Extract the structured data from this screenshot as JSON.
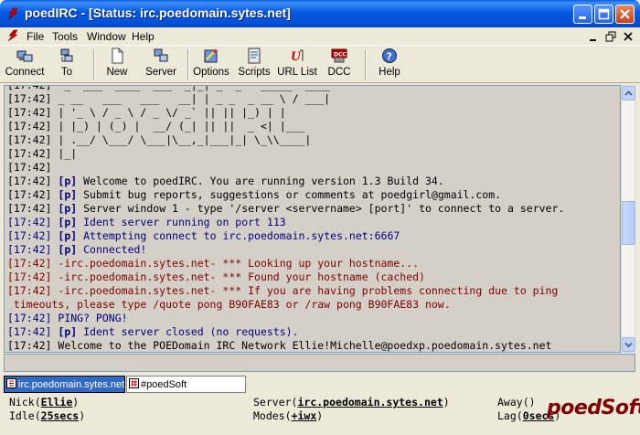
{
  "window": {
    "title": "poedIRC - [Status: irc.poedomain.sytes.net]"
  },
  "menu": {
    "items": [
      "File",
      "Tools",
      "Window",
      "Help"
    ]
  },
  "toolbar": {
    "buttons": [
      "Connect",
      "To",
      "New",
      "Server",
      "Options",
      "Scripts",
      "URL List",
      "DCC",
      "Help"
    ]
  },
  "log": {
    "lines": [
      {
        "ts": "[17:42]",
        "text": "  _  ___  ____  ___  _|_| _  _   _____  ____",
        "kind": "black"
      },
      {
        "ts": "[17:42]",
        "text": " _ __   ___   ___   __| | _ _  _ __ \\ / ___|",
        "kind": "black"
      },
      {
        "ts": "[17:42]",
        "text": " | '_ \\ / _ \\ / _ \\/ _` || || |_) | |",
        "kind": "black"
      },
      {
        "ts": "[17:42]",
        "text": " | |_) | (_) |  __/ (_| || ||  _ <| |___",
        "kind": "black"
      },
      {
        "ts": "[17:42]",
        "text": " | .__/ \\___/ \\___|\\__,_|___|_| \\_\\\\____|",
        "kind": "black"
      },
      {
        "ts": "[17:42]",
        "text": " |_|",
        "kind": "black"
      },
      {
        "ts": "[17:42]",
        "text": "",
        "kind": "black"
      },
      {
        "ts": "[17:42]",
        "tag": "[p]",
        "text": "Welcome to poedIRC. You are running version 1.3 Build 34.",
        "kind": "black"
      },
      {
        "ts": "[17:42]",
        "tag": "[p]",
        "text": "Submit bug reports, suggestions or comments at poedgirl@gmail.com.",
        "kind": "black"
      },
      {
        "ts": "[17:42]",
        "tag": "[p]",
        "text": "Server window 1 - type '/server <servername> [port]' to connect to a server.",
        "kind": "black"
      },
      {
        "ts": "[17:42]",
        "tag": "[p]",
        "text": "Ident server running on port 113",
        "kind": "blue"
      },
      {
        "ts": "[17:42]",
        "tag": "[p]",
        "text": "Attempting connect to irc.poedomain.sytes.net:6667",
        "kind": "blue"
      },
      {
        "ts": "[17:42]",
        "tag": "[p]",
        "text": "Connected!",
        "kind": "blue"
      },
      {
        "ts": "[17:42]",
        "text": " -irc.poedomain.sytes.net- *** Looking up your hostname...",
        "kind": "red"
      },
      {
        "ts": "[17:42]",
        "text": " -irc.poedomain.sytes.net- *** Found your hostname (cached)",
        "kind": "red"
      },
      {
        "ts": "[17:42]",
        "text": " -irc.poedomain.sytes.net- *** If you are having problems connecting due to ping",
        "kind": "red"
      },
      {
        "ts": "",
        "text": " timeouts, please type /quote pong B90FAE83 or /raw pong B90FAE83 now.",
        "kind": "red"
      },
      {
        "ts": "[17:42]",
        "text": " PING? PONG!",
        "kind": "blue"
      },
      {
        "ts": "[17:42]",
        "tag": "[p]",
        "text": "Ident server closed (no requests).",
        "kind": "blue"
      },
      {
        "ts": "[17:42]",
        "text": " Welcome to the POEDomain IRC Network Ellie!Michelle@poedxp.poedomain.sytes.net",
        "kind": "black"
      }
    ]
  },
  "input": {
    "value": ""
  },
  "tabs": [
    {
      "label": "irc.poedomain.sytes.net",
      "active": true
    },
    {
      "label": "#poedSoft",
      "active": false
    }
  ],
  "status": {
    "nick_label": "Nick",
    "nick_value": "Ellie",
    "idle_label": "Idle",
    "idle_value": "25secs",
    "server_label": "Server",
    "server_value": "irc.poedomain.sytes.net",
    "modes_label": "Modes",
    "modes_value": "+iwx",
    "away_label": "Away",
    "away_value": "",
    "lag_label": "Lag",
    "lag_value": "0secs"
  },
  "watermark": "poedSoft",
  "colors": {
    "blue": "#00007f",
    "red": "#7f0000",
    "title": "#0458e0"
  }
}
